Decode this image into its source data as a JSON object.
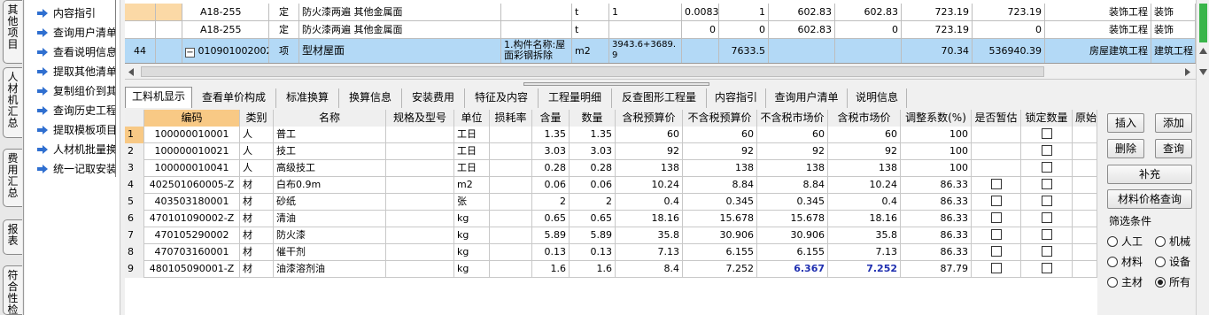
{
  "vtabs": [
    {
      "label": "其他项目"
    },
    {
      "label": "人材机汇总"
    },
    {
      "label": "费用汇总"
    },
    {
      "label": "报表"
    },
    {
      "label": "符合性检"
    }
  ],
  "menu": [
    {
      "label": "内容指引"
    },
    {
      "label": "查询用户清单"
    },
    {
      "label": "查看说明信息"
    },
    {
      "label": "提取其他清单"
    },
    {
      "label": "复制组价到其"
    },
    {
      "label": "查询历史工程"
    },
    {
      "label": "提取模板项目"
    },
    {
      "label": "人材机批量换"
    },
    {
      "label": "统一记取安装"
    }
  ],
  "top_rows": [
    {
      "num": "",
      "code": "A18-255",
      "unit_type": "定",
      "name": "防火漆两遍 其他金属面",
      "spec": "",
      "unit": "t",
      "qty_expr": "1",
      "content": "0.0083",
      "qty": "1",
      "price1": "602.83",
      "price2": "602.83",
      "price3": "723.19",
      "price4": "723.19",
      "category": "装饰工程",
      "extra": "装饰"
    },
    {
      "num": "",
      "code": "A18-255",
      "unit_type": "定",
      "name": "防火漆两遍 其他金属面",
      "spec": "",
      "unit": "t",
      "qty_expr": "",
      "content": "0",
      "qty": "0",
      "price1": "602.83",
      "price2": "0",
      "price3": "723.19",
      "price4": "0",
      "category": "装饰工程",
      "extra": "装饰"
    },
    {
      "num": "44",
      "code": "010901002002",
      "unit_type": "项",
      "name": "型材屋面",
      "spec": "1.构件名称:屋面彩钢拆除",
      "unit": "m2",
      "qty_expr": "3943.6+3689.9",
      "content": "",
      "qty": "7633.5",
      "price1": "",
      "price2": "",
      "price3": "70.34",
      "price4": "536940.39",
      "category": "房屋建筑工程",
      "extra": "建筑工程"
    }
  ],
  "tabs": [
    {
      "label": "工料机显示"
    },
    {
      "label": "查看单价构成"
    },
    {
      "label": "标准换算"
    },
    {
      "label": "换算信息"
    },
    {
      "label": "安装费用"
    },
    {
      "label": "特征及内容"
    },
    {
      "label": "工程量明细"
    },
    {
      "label": "反查图形工程量"
    },
    {
      "label": "内容指引"
    },
    {
      "label": "查询用户清单"
    },
    {
      "label": "说明信息"
    }
  ],
  "columns": [
    "编码",
    "类别",
    "名称",
    "规格及型号",
    "单位",
    "损耗率",
    "含量",
    "数量",
    "含税预算价",
    "不含税预算价",
    "不含税市场价",
    "含税市场价",
    "调整系数(%)",
    "是否暂估",
    "锁定数量",
    "原始"
  ],
  "rows": [
    {
      "no": "1",
      "code": "100000010001",
      "type": "人",
      "name": "普工",
      "spec": "",
      "unit": "工日",
      "loss": "",
      "content": "1.35",
      "qty": "1.35",
      "tax_budget": "60",
      "notax_budget": "60",
      "notax_market": "60",
      "tax_market": "60",
      "adjust": "100",
      "est": false,
      "lock": true
    },
    {
      "no": "2",
      "code": "100000010021",
      "type": "人",
      "name": "技工",
      "spec": "",
      "unit": "工日",
      "loss": "",
      "content": "3.03",
      "qty": "3.03",
      "tax_budget": "92",
      "notax_budget": "92",
      "notax_market": "92",
      "tax_market": "92",
      "adjust": "100",
      "est": false,
      "lock": true
    },
    {
      "no": "3",
      "code": "100000010041",
      "type": "人",
      "name": "高级技工",
      "spec": "",
      "unit": "工日",
      "loss": "",
      "content": "0.28",
      "qty": "0.28",
      "tax_budget": "138",
      "notax_budget": "138",
      "notax_market": "138",
      "tax_market": "138",
      "adjust": "100",
      "est": false,
      "lock": true
    },
    {
      "no": "4",
      "code": "402501060005-Z",
      "type": "材",
      "name": "白布0.9m",
      "spec": "",
      "unit": "m2",
      "loss": "",
      "content": "0.06",
      "qty": "0.06",
      "tax_budget": "10.24",
      "notax_budget": "8.84",
      "notax_market": "8.84",
      "tax_market": "10.24",
      "adjust": "86.33",
      "est": true,
      "lock": true
    },
    {
      "no": "5",
      "code": "403503180001",
      "type": "材",
      "name": "砂纸",
      "spec": "",
      "unit": "张",
      "loss": "",
      "content": "2",
      "qty": "2",
      "tax_budget": "0.4",
      "notax_budget": "0.345",
      "notax_market": "0.345",
      "tax_market": "0.4",
      "adjust": "86.33",
      "est": true,
      "lock": true
    },
    {
      "no": "6",
      "code": "470101090002-Z",
      "type": "材",
      "name": "清油",
      "spec": "",
      "unit": "kg",
      "loss": "",
      "content": "0.65",
      "qty": "0.65",
      "tax_budget": "18.16",
      "notax_budget": "15.678",
      "notax_market": "15.678",
      "tax_market": "18.16",
      "adjust": "86.33",
      "est": true,
      "lock": true
    },
    {
      "no": "7",
      "code": "470105290002",
      "type": "材",
      "name": "防火漆",
      "spec": "",
      "unit": "kg",
      "loss": "",
      "content": "5.89",
      "qty": "5.89",
      "tax_budget": "35.8",
      "notax_budget": "30.906",
      "notax_market": "30.906",
      "tax_market": "35.8",
      "adjust": "86.33",
      "est": true,
      "lock": true
    },
    {
      "no": "8",
      "code": "470703160001",
      "type": "材",
      "name": "催干剂",
      "spec": "",
      "unit": "kg",
      "loss": "",
      "content": "0.13",
      "qty": "0.13",
      "tax_budget": "7.13",
      "notax_budget": "6.155",
      "notax_market": "6.155",
      "tax_market": "7.13",
      "adjust": "86.33",
      "est": true,
      "lock": true
    },
    {
      "no": "9",
      "code": "480105090001-Z",
      "type": "材",
      "name": "油漆溶剂油",
      "spec": "",
      "unit": "kg",
      "loss": "",
      "content": "1.6",
      "qty": "1.6",
      "tax_budget": "8.4",
      "notax_budget": "7.252",
      "notax_market": "6.367",
      "tax_market": "7.252",
      "adjust": "87.79",
      "est": true,
      "lock": true,
      "highlight": true
    }
  ],
  "buttons": {
    "insert": "插入",
    "add": "添加",
    "delete": "删除",
    "query": "查询",
    "supplement": "补充",
    "price_query": "材料价格查询"
  },
  "filter": {
    "title": "筛选条件",
    "options": [
      {
        "label": "人工",
        "checked": false
      },
      {
        "label": "机械",
        "checked": false
      },
      {
        "label": "材料",
        "checked": false
      },
      {
        "label": "设备",
        "checked": false
      },
      {
        "label": "主材",
        "checked": false
      },
      {
        "label": "所有",
        "checked": true
      }
    ]
  },
  "colors": {
    "selected_row": "#b3d9f6",
    "header_highlight": "#f8c985",
    "value_blue": "#1f2fb0"
  }
}
